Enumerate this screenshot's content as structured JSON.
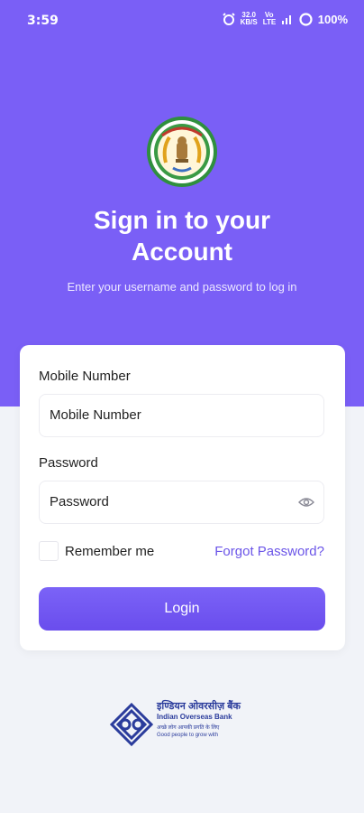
{
  "status_bar": {
    "time": "3:59",
    "data_speed_top": "32.0",
    "data_speed_bottom": "KB/S",
    "network": "Vo LTE",
    "battery": "100%"
  },
  "header": {
    "title_line1": "Sign in to your",
    "title_line2": "Account",
    "subtitle": "Enter your username and password to log in"
  },
  "form": {
    "mobile_label": "Mobile Number",
    "mobile_placeholder": "Mobile Number",
    "password_label": "Password",
    "password_placeholder": "Password",
    "remember_label": "Remember me",
    "forgot_label": "Forgot Password?",
    "login_label": "Login"
  },
  "footer": {
    "bank_name_hindi": "इण्डियन ओवरसीज़ बैंक",
    "bank_name": "Indian Overseas Bank",
    "tagline_hindi": "अच्छे लोग आपकी प्रगति के लिए",
    "tagline": "Good people to grow with"
  },
  "colors": {
    "primary": "#7a5ff6",
    "background": "#f1f3f8",
    "link": "#6b55e8"
  }
}
